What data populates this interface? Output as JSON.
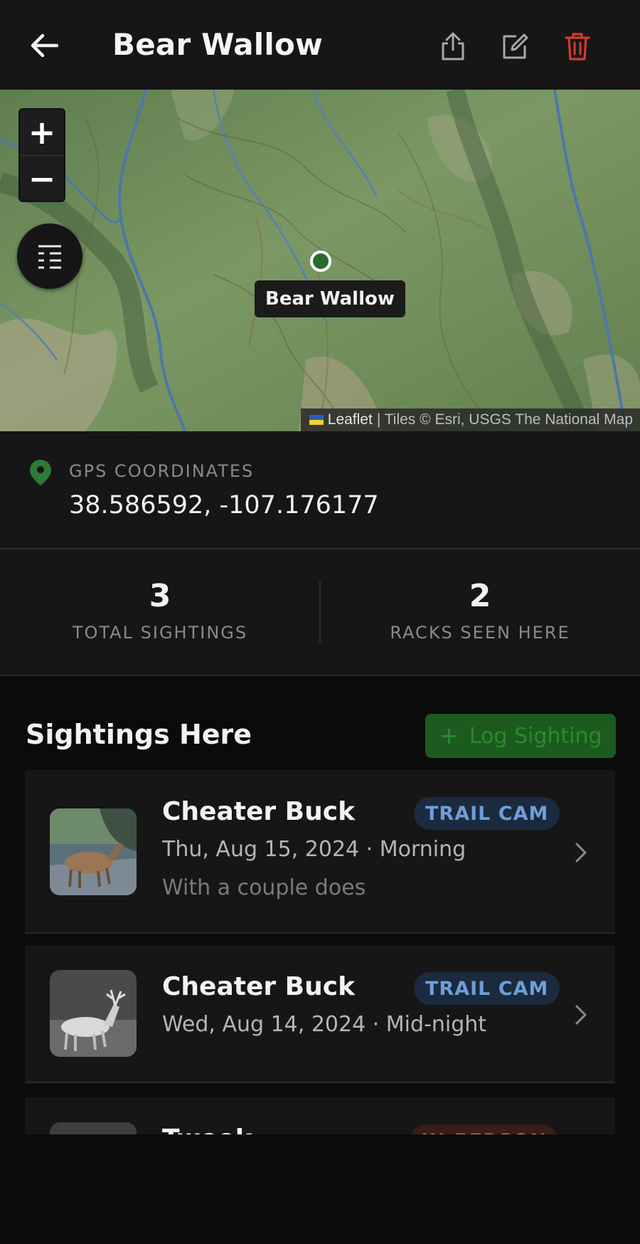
{
  "header": {
    "title": "Bear Wallow"
  },
  "map": {
    "zoom_in": "+",
    "zoom_out": "−",
    "marker_label": "Bear Wallow",
    "attribution": {
      "leaflet": "Leaflet",
      "tiles": "| Tiles © Esri, USGS The National Map"
    },
    "marker_color": "#2a6b2c"
  },
  "gps": {
    "label": "GPS COORDINATES",
    "value": "38.586592, -107.176177"
  },
  "stats": {
    "total_sightings": {
      "value": "3",
      "label": "TOTAL SIGHTINGS"
    },
    "racks_seen": {
      "value": "2",
      "label": "RACKS SEEN HERE"
    }
  },
  "sightings": {
    "title": "Sightings Here",
    "log_button": "Log Sighting",
    "items": [
      {
        "name": "Cheater Buck",
        "badge": "TRAIL CAM",
        "date": "Thu, Aug 15, 2024 · Morning",
        "note": "With a couple does"
      },
      {
        "name": "Cheater Buck",
        "badge": "TRAIL CAM",
        "date": "Wed, Aug 14, 2024 · Mid-night",
        "note": ""
      },
      {
        "name": "Tweek",
        "badge": "IN-PERSON",
        "date": "",
        "note": ""
      }
    ]
  },
  "colors": {
    "accent_green": "#2a6b2c",
    "delete_red": "#d63a2f",
    "trail_cam_badge": "#6f9ed6",
    "in_person_badge": "#cc6650"
  }
}
